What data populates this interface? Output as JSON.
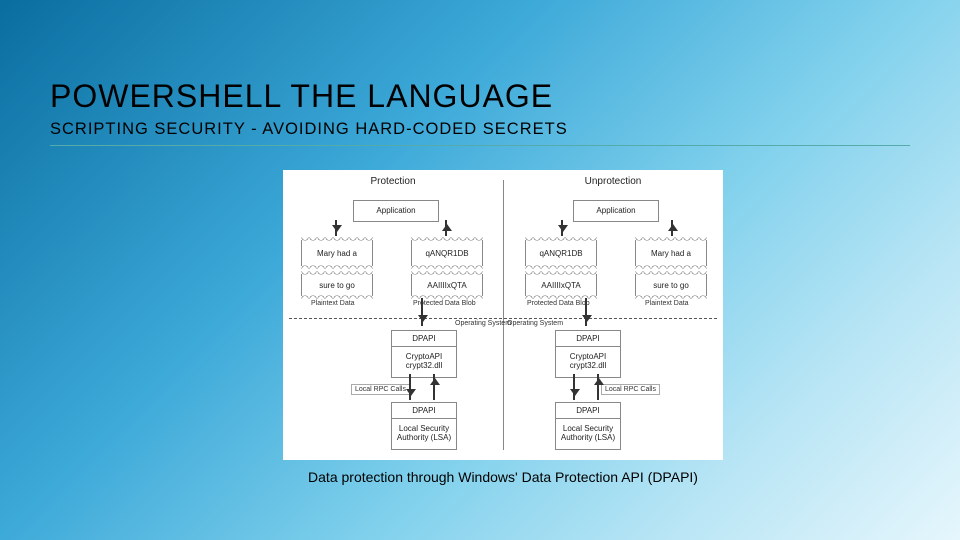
{
  "title": "POWERSHELL THE LANGUAGE",
  "subtitle": "SCRIPTING SECURITY - AVOIDING HARD-CODED SECRETS",
  "caption": "Data protection through Windows' Data Protection API (DPAPI)",
  "diagram": {
    "left_header": "Protection",
    "right_header": "Unprotection",
    "application": "Application",
    "plain_sample": "Mary had a",
    "plain_sample2": "sure to go",
    "plain_label": "Plaintext Data",
    "cipher_sample": "qANQR1DB",
    "cipher_sample2": "AAIIIIxQTA",
    "cipher_label": "Protected Data Blob",
    "left_plain_sample": "Mary had a",
    "os_label_l": "Operating System",
    "os_label_r": "Operating System",
    "dpapi": "DPAPI",
    "crypto1": "CryptoAPI",
    "crypto2": "crypt32.dll",
    "rpc": "Local RPC Calls",
    "lsa1": "Local Security",
    "lsa2": "Authority (LSA)"
  }
}
